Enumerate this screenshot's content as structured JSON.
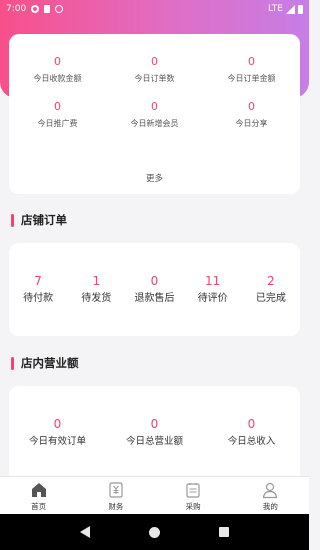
{
  "status_bar": {
    "time": "7:00",
    "network": "LTE"
  },
  "stats": {
    "items": [
      {
        "value": "0",
        "label": "今日收款金额"
      },
      {
        "value": "0",
        "label": "今日订单数"
      },
      {
        "value": "0",
        "label": "今日订单金额"
      },
      {
        "value": "0",
        "label": "今日推广费"
      },
      {
        "value": "0",
        "label": "今日新增会员"
      },
      {
        "value": "0",
        "label": "今日分享"
      }
    ],
    "more_label": "更多"
  },
  "orders": {
    "title": "店铺订单",
    "items": [
      {
        "value": "7",
        "label": "待付款"
      },
      {
        "value": "1",
        "label": "待发货"
      },
      {
        "value": "0",
        "label": "退款售后"
      },
      {
        "value": "11",
        "label": "待评价"
      },
      {
        "value": "2",
        "label": "已完成"
      }
    ]
  },
  "business": {
    "title": "店内营业额",
    "items": [
      {
        "value": "0",
        "label": "今日有效订单"
      },
      {
        "value": "0",
        "label": "今日总营业额"
      },
      {
        "value": "0",
        "label": "今日总收入"
      }
    ]
  },
  "tabbar": {
    "items": [
      {
        "label": "首页",
        "icon": "home-icon"
      },
      {
        "label": "财务",
        "icon": "finance-icon"
      },
      {
        "label": "采购",
        "icon": "purchase-icon"
      },
      {
        "label": "我的",
        "icon": "profile-icon"
      }
    ]
  },
  "colors": {
    "accent": "#f2446e",
    "gradient_start": "#f84f8a",
    "gradient_end": "#c67ee6"
  }
}
